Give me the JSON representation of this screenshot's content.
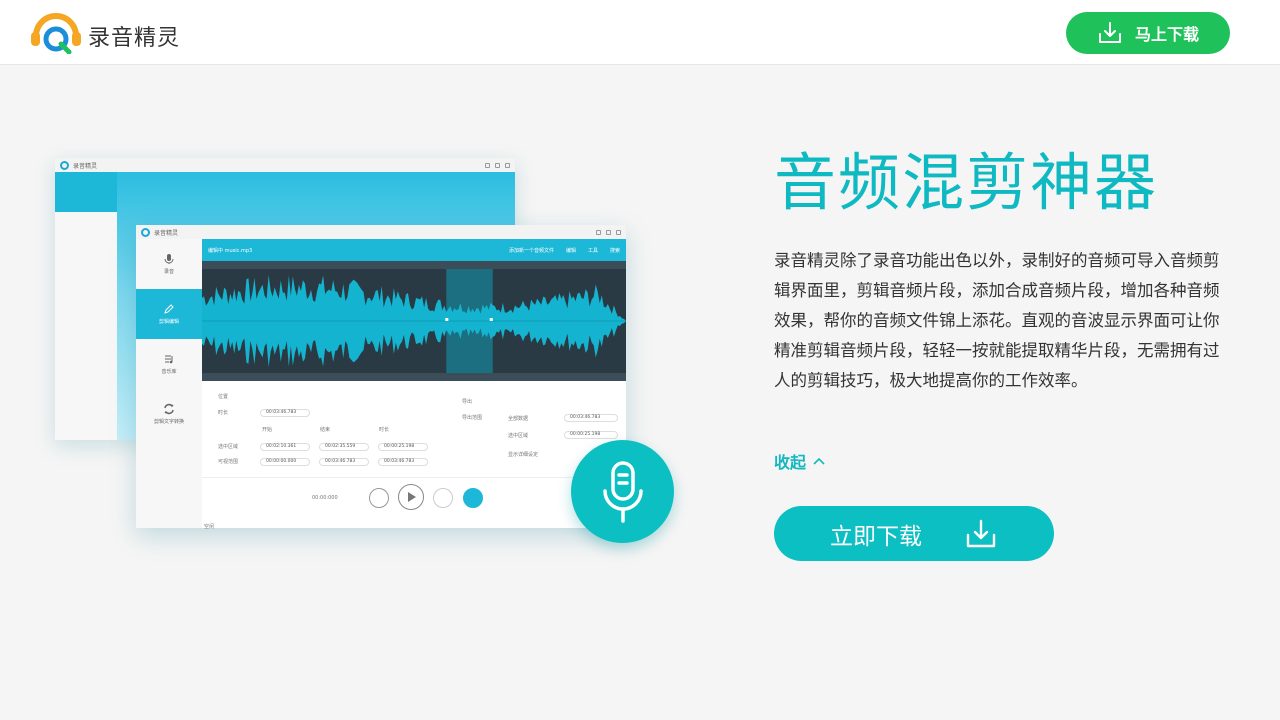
{
  "header": {
    "brand": "录音精灵",
    "download_label": "马上下载"
  },
  "hero": {
    "title": "音频混剪神器",
    "description": "录音精灵除了录音功能出色以外，录制好的音频可导入音频剪辑界面里，剪辑音频片段，添加合成音频片段，增加各种音频效果，帮你的音频文件锦上添花。直观的音波显示界面可让你精准剪辑音频片段，轻轻一按就能提取精华片段，无需拥有过人的剪辑技巧，极大地提高你的工作效率。",
    "collapse_label": "收起",
    "download_label": "立即下载"
  },
  "app_window": {
    "title": "录音精灵",
    "sidebar": [
      {
        "label": "录音",
        "icon": "mic-icon"
      },
      {
        "label": "剪辑编辑",
        "icon": "pencil-icon"
      },
      {
        "label": "音乐库",
        "icon": "music-list-icon"
      },
      {
        "label": "剪辑文字转换",
        "icon": "convert-icon"
      }
    ],
    "editbar": {
      "file": "编辑中 music.mp3",
      "add": "添加新一个音频文件",
      "edit": "编辑",
      "tools": "工具",
      "search": "搜索"
    },
    "fields": {
      "position": "位置",
      "duration_label": "时长",
      "duration_value": "00:03:46.783",
      "start": "开始",
      "end": "结束",
      "length": "时长",
      "sel_label": "选中区域",
      "sel_start": "00:02:10.361",
      "sel_end": "00:02:35.559",
      "sel_len": "00:00:25.198",
      "vis_label": "可视范围",
      "vis_start": "00:00:00.000",
      "vis_end": "00:03:46.783",
      "vis_len": "00:03:46.783",
      "export": "导出",
      "export_range": "导出范围",
      "all": "全部数据",
      "all_value": "00:03:46.783",
      "selected": "选中区域",
      "selected_value": "00:00:25.198",
      "detail": "显示详细设定",
      "time": "00:00:000",
      "status": "空闲"
    }
  }
}
